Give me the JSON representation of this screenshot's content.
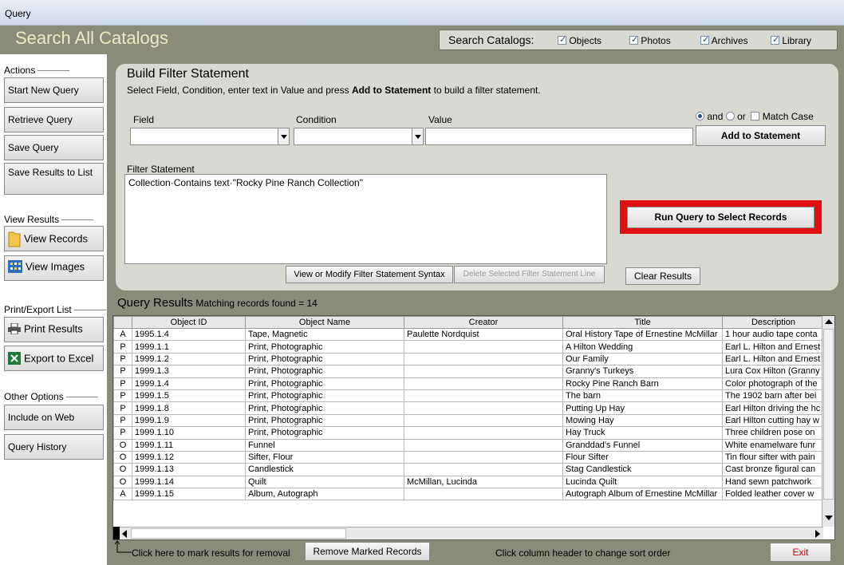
{
  "window": {
    "title": "Query"
  },
  "header": {
    "app_title": "Search All Catalogs",
    "catalogs_label": "Search Catalogs:",
    "catalogs": [
      {
        "label": "Objects",
        "checked": true
      },
      {
        "label": "Photos",
        "checked": true
      },
      {
        "label": "Archives",
        "checked": true
      },
      {
        "label": "Library",
        "checked": true
      }
    ]
  },
  "sidebar": {
    "actions_label": "Actions",
    "start_new_query": "Start New Query",
    "retrieve_query": "Retrieve Query",
    "save_query": "Save Query",
    "save_results": "Save Results to List",
    "view_results_label": "View Results",
    "view_records": "View Records",
    "view_images": "View Images",
    "print_export_label": "Print/Export List",
    "print_results": "Print Results",
    "export_excel": "Export to Excel",
    "other_options_label": "Other Options",
    "include_on_web": "Include on Web",
    "query_history": "Query History"
  },
  "builder": {
    "title": "Build Filter Statement",
    "instructions_pre": "Select Field, Condition, enter text in Value and press ",
    "instructions_bold": "Add to Statement",
    "instructions_post": " to build a filter statement.",
    "field_label": "Field",
    "condition_label": "Condition",
    "value_label": "Value",
    "field_value": "",
    "condition_value": "",
    "value_value": "",
    "and_label": "and",
    "or_label": "or",
    "match_case_label": "Match Case",
    "add_to_statement": "Add to Statement",
    "filter_statement_label": "Filter Statement",
    "filter_statement_text": "Collection·Contains text·\"Rocky Pine Ranch Collection\"",
    "run_query": "Run Query to Select Records",
    "view_modify_syntax": "View or Modify Filter Statement Syntax",
    "delete_line": "Delete Selected Filter Statement Line",
    "clear_results": "Clear Results"
  },
  "results": {
    "title": "Query Results",
    "count_text": "Matching records found = 14",
    "columns": [
      "",
      "Object ID",
      "Object Name",
      "Creator",
      "Title",
      "Description"
    ],
    "rows": [
      [
        "A",
        "1995.1.4",
        "Tape, Magnetic",
        "Paulette Nordquist",
        "Oral History Tape of Ernestine McMillar",
        "1 hour audio tape conta"
      ],
      [
        "P",
        "1999.1.1",
        "Print, Photographic",
        "",
        "A Hilton Wedding",
        "Earl L. Hilton and Ernest"
      ],
      [
        "P",
        "1999.1.2",
        "Print, Photographic",
        "",
        "Our Family",
        "Earl L. Hilton and Ernest"
      ],
      [
        "P",
        "1999.1.3",
        "Print, Photographic",
        "",
        "Granny's Turkeys",
        "Lura Cox Hilton (Granny"
      ],
      [
        "P",
        "1999.1.4",
        "Print, Photographic",
        "",
        "Rocky Pine Ranch Barn",
        "Color photograph of the"
      ],
      [
        "P",
        "1999.1.5",
        "Print, Photographic",
        "",
        "The barn",
        "The 1902 barn after bei"
      ],
      [
        "P",
        "1999.1.8",
        "Print, Photographic",
        "",
        "Putting Up Hay",
        "Earl Hilton driving the hc"
      ],
      [
        "P",
        "1999.1.9",
        "Print, Photographic",
        "",
        "Mowing Hay",
        "Earl Hilton cutting hay w"
      ],
      [
        "P",
        "1999.1.10",
        "Print, Photographic",
        "",
        "Hay Truck",
        "Three children pose on"
      ],
      [
        "O",
        "1999.1.11",
        "Funnel",
        "",
        "Granddad's Funnel",
        "White enamelware funr"
      ],
      [
        "O",
        "1999.1.12",
        "Sifter, Flour",
        "",
        "Flour Sifter",
        "Tin flour sifter with pain"
      ],
      [
        "O",
        "1999.1.13",
        "Candlestick",
        "",
        "Stag Candlestick",
        "Cast bronze figural can"
      ],
      [
        "O",
        "1999.1.14",
        "Quilt",
        "McMillan, Lucinda",
        "Lucinda Quilt",
        "Hand sewn patchwork"
      ],
      [
        "A",
        "1999.1.15",
        "Album, Autograph",
        "",
        "Autograph Album of Ernestine McMillar",
        "Folded leather cover w"
      ]
    ]
  },
  "footer": {
    "mark_hint": "Click here to mark results for removal",
    "remove_marked": "Remove Marked Records",
    "sort_hint": "Click column header to change sort order",
    "exit": "Exit"
  },
  "colors": {
    "header_bg": "#8b8b7a",
    "title_text": "#eaeac2",
    "panel_bg": "#d9d9d2",
    "run_highlight": "#e01010",
    "exit_text": "#cc0000"
  }
}
